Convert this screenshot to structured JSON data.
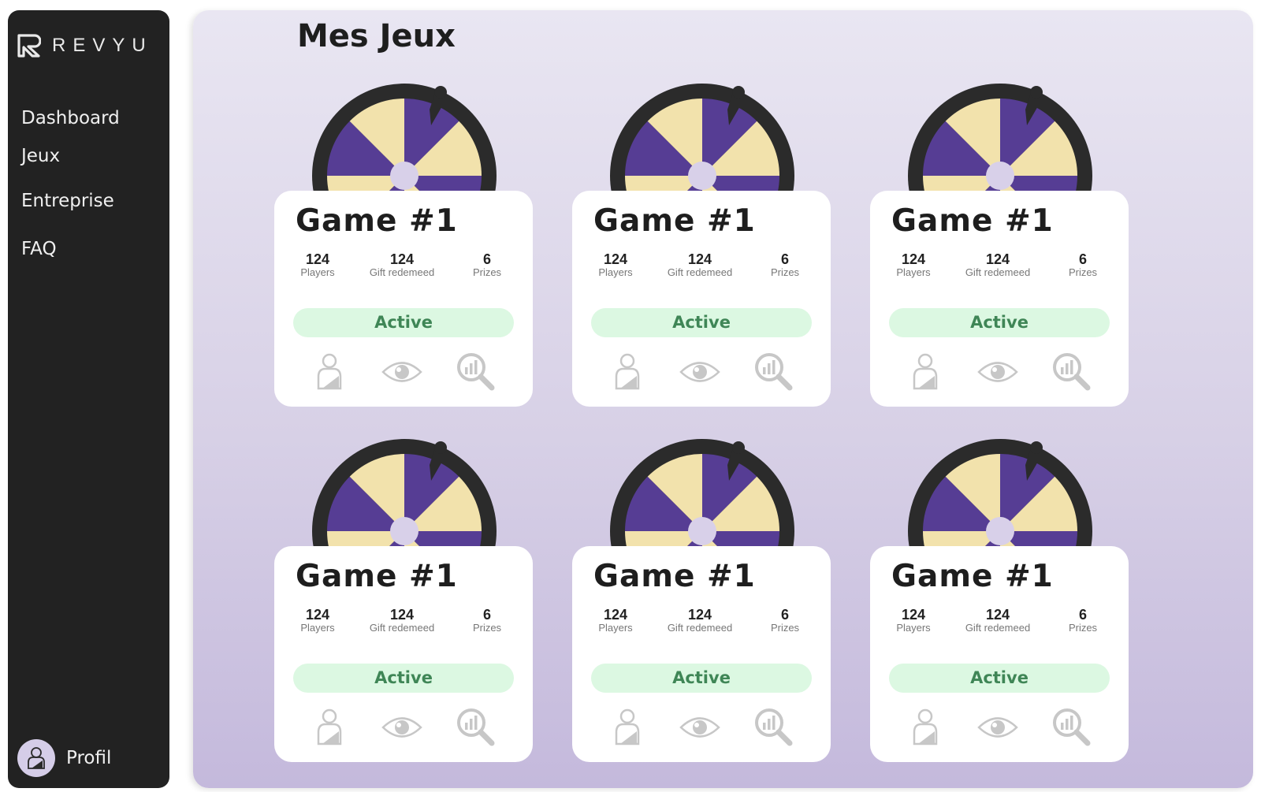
{
  "brand": {
    "name": "REVYU"
  },
  "sidebar": {
    "items": [
      {
        "label": "Dashboard"
      },
      {
        "label": "Jeux"
      },
      {
        "label": "Entreprise"
      },
      {
        "label": "FAQ"
      }
    ],
    "profile_label": "Profil"
  },
  "main": {
    "title": "Mes Jeux"
  },
  "games": [
    {
      "title": "Game #1",
      "stats": [
        {
          "value": "124",
          "label": "Players"
        },
        {
          "value": "124",
          "label": "Gift redemeed"
        },
        {
          "value": "6",
          "label": "Prizes"
        }
      ],
      "status": "Active"
    },
    {
      "title": "Game #1",
      "stats": [
        {
          "value": "124",
          "label": "Players"
        },
        {
          "value": "124",
          "label": "Gift redemeed"
        },
        {
          "value": "6",
          "label": "Prizes"
        }
      ],
      "status": "Active"
    },
    {
      "title": "Game #1",
      "stats": [
        {
          "value": "124",
          "label": "Players"
        },
        {
          "value": "124",
          "label": "Gift redemeed"
        },
        {
          "value": "6",
          "label": "Prizes"
        }
      ],
      "status": "Active"
    },
    {
      "title": "Game #1",
      "stats": [
        {
          "value": "124",
          "label": "Players"
        },
        {
          "value": "124",
          "label": "Gift redemeed"
        },
        {
          "value": "6",
          "label": "Prizes"
        }
      ],
      "status": "Active"
    },
    {
      "title": "Game #1",
      "stats": [
        {
          "value": "124",
          "label": "Players"
        },
        {
          "value": "124",
          "label": "Gift redemeed"
        },
        {
          "value": "6",
          "label": "Prizes"
        }
      ],
      "status": "Active"
    },
    {
      "title": "Game #1",
      "stats": [
        {
          "value": "124",
          "label": "Players"
        },
        {
          "value": "124",
          "label": "Gift redemeed"
        },
        {
          "value": "6",
          "label": "Prizes"
        }
      ],
      "status": "Active"
    }
  ],
  "icons": {
    "players": "user-icon",
    "preview": "eye-icon",
    "stats": "analytics-search-icon",
    "wheel": "prize-wheel-icon"
  },
  "colors": {
    "sidebar": "#222222",
    "wheel_purple": "#563d94",
    "wheel_cream": "#f2e2ac",
    "status_bg": "#dcf8e2",
    "status_text": "#3f8656"
  }
}
